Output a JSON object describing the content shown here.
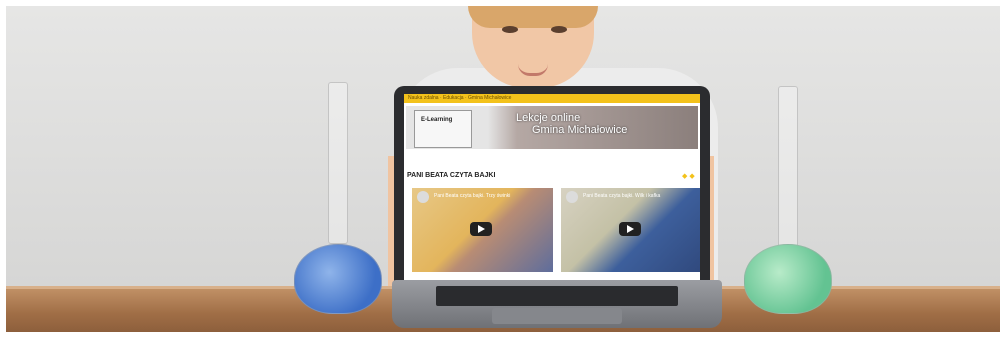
{
  "screen": {
    "topbar_text": "Nauka zdalna · Edukacja · Gmina Michałowice",
    "logo_text": "E-Learning",
    "banner_title_line1": "Lekcje online",
    "banner_title_line2": "Gmina Michałowice",
    "section_heading": "PANI BEATA CZYTA BAJKI",
    "videos": [
      {
        "title": "Pani Beata czyta bajki. Trzy świnki"
      },
      {
        "title": "Pani Beata czyta bajki. Wilk i kafka"
      }
    ]
  },
  "colors": {
    "accent_yellow": "#f3c21b",
    "left_flask_liquid": "#3d6fc7",
    "right_flask_liquid": "#63c392"
  }
}
